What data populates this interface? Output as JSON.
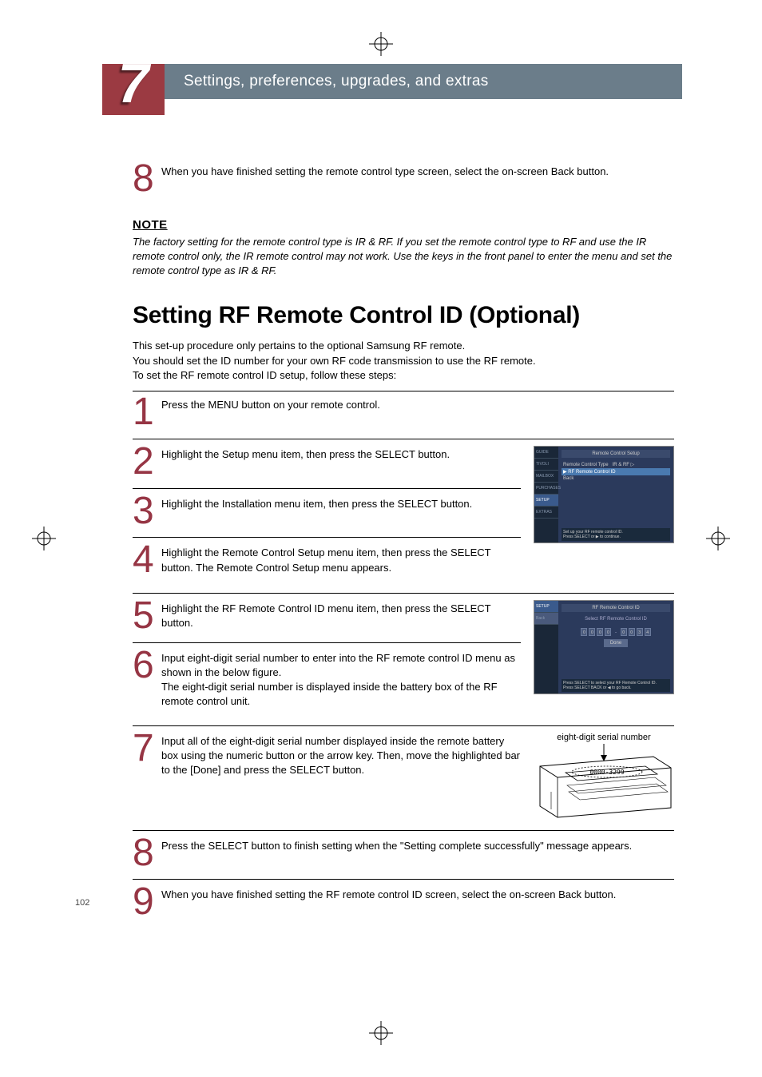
{
  "chapter": {
    "number": "7",
    "title": "Settings, preferences, upgrades, and extras"
  },
  "page_number": "102",
  "top_step": {
    "num": "8",
    "text": "When you have finished setting the remote control type screen, select the on-screen Back button."
  },
  "note": {
    "heading": "NOTE",
    "text": "The factory setting for the remote control type is IR & RF. If you set the remote control type to RF and use the IR remote control only, the IR remote control may not work. Use the keys in the front panel to enter the menu and set the remote control type as IR & RF."
  },
  "section": {
    "title": "Setting RF Remote Control ID (Optional)",
    "intro": "This set-up procedure only pertains to the optional Samsung RF remote.\nYou should set the ID number for your own RF code transmission to use the RF remote.\nTo set the RF remote control ID setup, follow these steps:"
  },
  "steps": [
    {
      "num": "1",
      "text": "Press the MENU button on your remote control."
    },
    {
      "num": "2",
      "text": "Highlight the Setup menu item, then press the SELECT button."
    },
    {
      "num": "3",
      "text": "Highlight the Installation menu item, then press the SELECT button."
    },
    {
      "num": "4",
      "text": "Highlight the Remote Control Setup menu item, then press the SELECT button. The Remote Control Setup menu appears."
    },
    {
      "num": "5",
      "text": "Highlight the RF Remote Control ID menu item, then press the SELECT button."
    },
    {
      "num": "6",
      "text": "Input eight-digit serial number to enter into the RF remote control ID menu as shown in the below figure.\nThe eight-digit serial number is displayed inside the battery box of the RF remote control unit."
    },
    {
      "num": "7",
      "text": "Input all of the eight-digit serial number displayed inside the remote battery box using the numeric button or the arrow key. Then, move the highlighted bar to the [Done] and press the SELECT button."
    },
    {
      "num": "8",
      "text": "Press the SELECT button to finish setting when the \"Setting complete successfully\" message appears."
    },
    {
      "num": "9",
      "text": "When you have finished setting the RF remote control ID screen, select the on-screen Back button."
    }
  ],
  "screenshot1": {
    "title": "Remote Control Setup",
    "sidebar": [
      "GUIDE",
      "TIVOLI",
      "MAILBOX",
      "PURCHASES",
      "SETUP",
      "EXTRAS"
    ],
    "rows": [
      {
        "label": "Remote Control Type",
        "value": "IR & RF"
      },
      {
        "label": "RF Remote Control ID",
        "value": ""
      },
      {
        "label": "Back",
        "value": ""
      }
    ],
    "footer": "Set up your RF remote control ID.\nPress SELECT or ▶ to continue."
  },
  "screenshot2": {
    "sidebar_label": "SETUP",
    "back_label": "Back",
    "title": "RF Remote Control ID",
    "subtitle": "Select RF Remote Control ID",
    "digits": [
      "0",
      "0",
      "0",
      "0",
      "-",
      "0",
      "0",
      "3",
      "4"
    ],
    "done": "Done",
    "footer": "Press SELECT to select your RF Remote Control ID.\nPress SELECT BACK or ◀ to go back."
  },
  "diagram": {
    "label": "eight-digit serial number",
    "serial": "0000-3299"
  }
}
